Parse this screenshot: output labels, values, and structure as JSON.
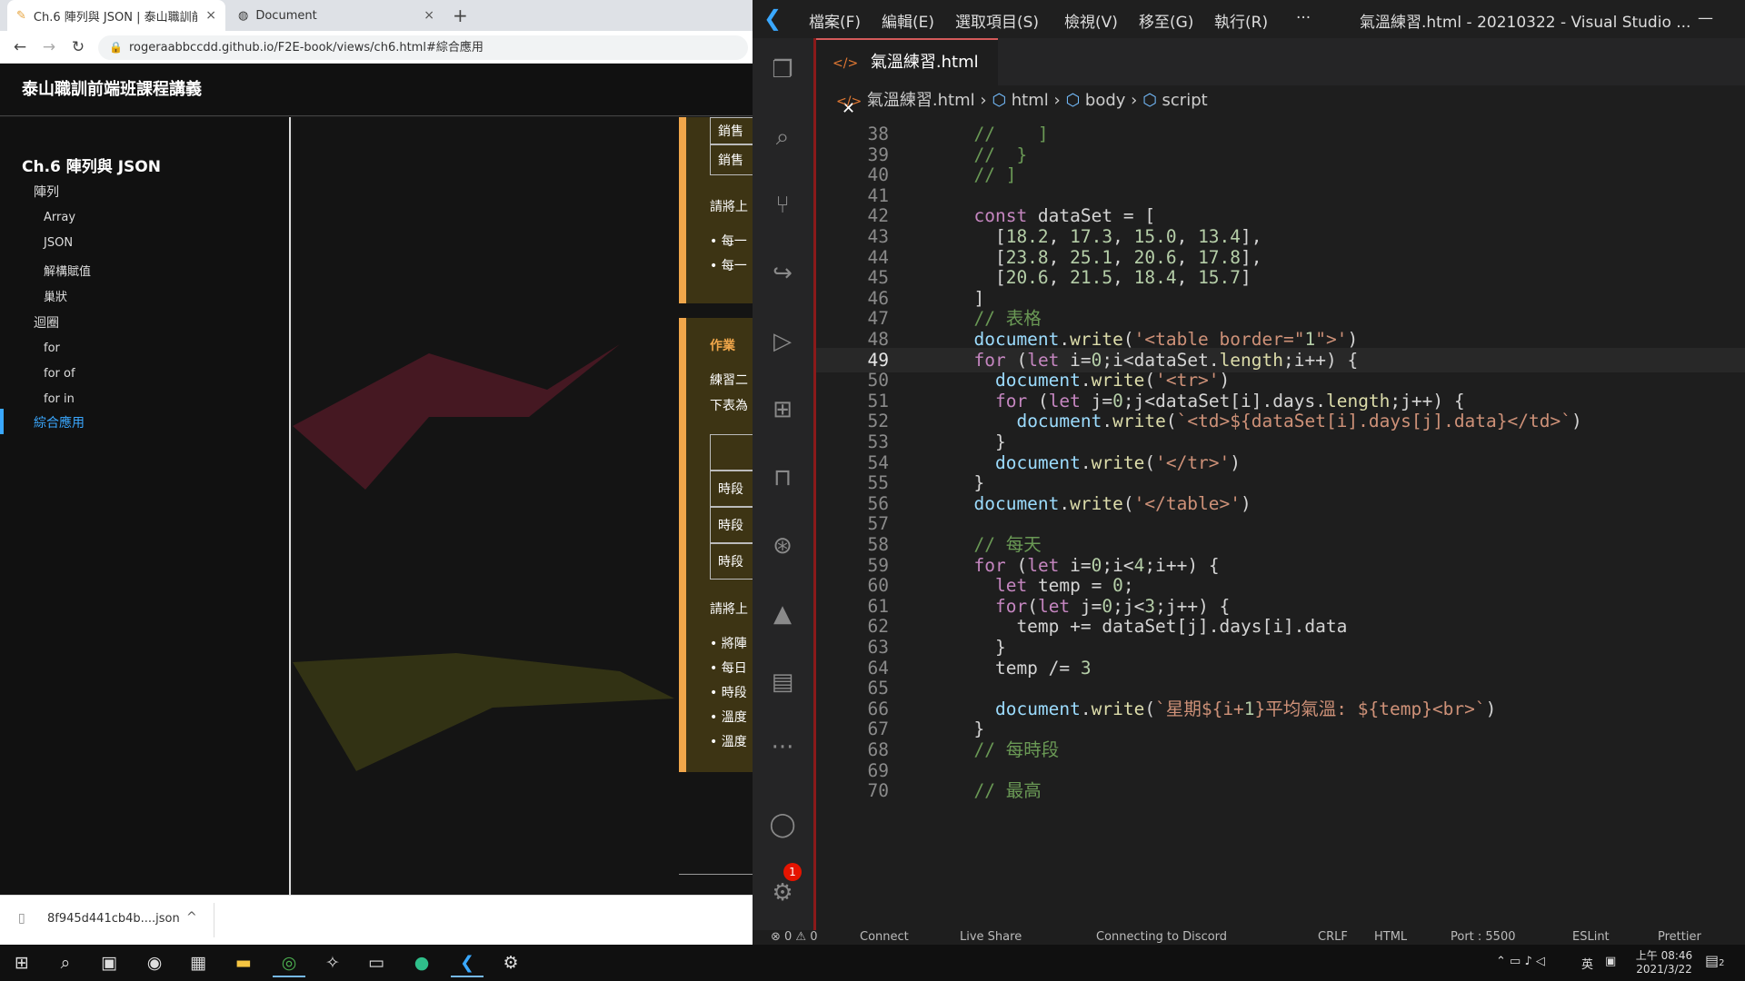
{
  "browser": {
    "tabs": [
      {
        "title": "Ch.6 陣列與 JSON | 泰山職訓前",
        "close": "×"
      },
      {
        "title": "Document",
        "close": "×"
      }
    ],
    "new_tab": "+",
    "url": "rogeraabbccdd.github.io/F2E-book/views/ch6.html#綜合應用",
    "site_title": "泰山職訓前端班課程講義",
    "sidebar": {
      "chapter": "Ch.6 陣列與 JSON",
      "groups": [
        {
          "label": "陣列",
          "items": [
            "Array",
            "JSON",
            "解構賦值",
            "巢狀"
          ]
        },
        {
          "label": "迴圈",
          "items": [
            "for",
            "for of",
            "for in"
          ]
        }
      ],
      "active": "綜合應用"
    },
    "content": {
      "cells_top": [
        "銷售",
        "銷售"
      ],
      "hint1": "請將上",
      "bullets1": [
        "每一",
        "每一"
      ],
      "homework_label": "作業",
      "hw_text1": "練習二",
      "hw_text2": "下表為",
      "cells_mid": [
        "時段",
        "時段",
        "時段"
      ],
      "hint2": "請將上",
      "bullets2": [
        "將陣",
        "每日",
        "時段",
        "溫度",
        "溫度"
      ]
    },
    "download": {
      "filename": "8f945d441cb4b....json",
      "chevron": "^"
    }
  },
  "vscode": {
    "menu": [
      "檔案(F)",
      "編輯(E)",
      "選取項目(S)",
      "檢視(V)",
      "移至(G)",
      "執行(R)",
      "···"
    ],
    "window_title": "氣溫練習.html - 20210322 - Visual Studio ...",
    "minimize": "—",
    "file_tab": "氣溫練習.html",
    "breadcrumb": [
      "氣溫練習.html",
      "html",
      "body",
      "script"
    ],
    "badge_count": "1",
    "current_line": 49,
    "code_lines": [
      {
        "n": "38",
        "text": "  //    ]"
      },
      {
        "n": "39",
        "text": "  //  }"
      },
      {
        "n": "40",
        "text": "  // ]"
      },
      {
        "n": "41",
        "text": ""
      },
      {
        "n": "42",
        "text": "  const dataSet = ["
      },
      {
        "n": "43",
        "text": "    [18.2, 17.3, 15.0, 13.4],"
      },
      {
        "n": "44",
        "text": "    [23.8, 25.1, 20.6, 17.8],"
      },
      {
        "n": "45",
        "text": "    [20.6, 21.5, 18.4, 15.7]"
      },
      {
        "n": "46",
        "text": "  ]"
      },
      {
        "n": "47",
        "text": "  // 表格"
      },
      {
        "n": "48",
        "text": "  document.write('<table border=\"1\">')"
      },
      {
        "n": "49",
        "text": "  for (let i=0;i<dataSet.length;i++) {"
      },
      {
        "n": "50",
        "text": "    document.write('<tr>')"
      },
      {
        "n": "51",
        "text": "    for (let j=0;j<dataSet[i].days.length;j++) {"
      },
      {
        "n": "52",
        "text": "      document.write(`<td>${dataSet[i].days[j].data}</td>`)"
      },
      {
        "n": "53",
        "text": "    }"
      },
      {
        "n": "54",
        "text": "    document.write('</tr>')"
      },
      {
        "n": "55",
        "text": "  }"
      },
      {
        "n": "56",
        "text": "  document.write('</table>')"
      },
      {
        "n": "57",
        "text": ""
      },
      {
        "n": "58",
        "text": "  // 每天"
      },
      {
        "n": "59",
        "text": "  for (let i=0;i<4;i++) {"
      },
      {
        "n": "60",
        "text": "    let temp = 0;"
      },
      {
        "n": "61",
        "text": "    for(let j=0;j<3;j++) {"
      },
      {
        "n": "62",
        "text": "      temp += dataSet[j].days[i].data"
      },
      {
        "n": "63",
        "text": "    }"
      },
      {
        "n": "64",
        "text": "    temp /= 3"
      },
      {
        "n": "65",
        "text": ""
      },
      {
        "n": "66",
        "text": "    document.write(`星期${i+1}平均氣溫: ${temp}<br>`)"
      },
      {
        "n": "67",
        "text": "  }"
      },
      {
        "n": "68",
        "text": "  // 每時段"
      },
      {
        "n": "69",
        "text": ""
      },
      {
        "n": "70",
        "text": "  // 最高"
      }
    ],
    "status": [
      "⊗ 0 ⚠ 0",
      "Connect",
      "Live Share",
      "Connecting to Discord",
      "CRLF",
      "HTML",
      "Port : 5500",
      "ESLint",
      "Prettier"
    ]
  },
  "taskbar": {
    "time": "上午 08:46",
    "date": "2021/3/22",
    "ime": "英",
    "notif_count": "2"
  },
  "colors": {
    "accent_orange": "#f0a64a",
    "vscode_blue": "#3aa8ff",
    "keyword": "#c586c0"
  }
}
